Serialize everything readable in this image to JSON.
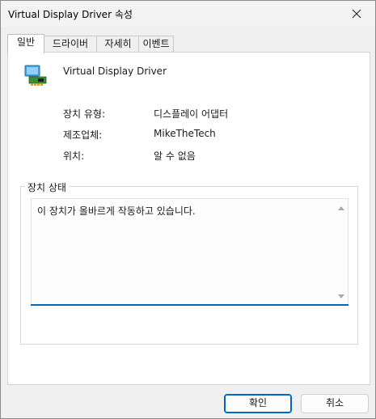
{
  "window": {
    "title": "Virtual Display Driver 속성"
  },
  "tabs": [
    {
      "label": "일반"
    },
    {
      "label": "드라이버"
    },
    {
      "label": "자세히"
    },
    {
      "label": "이벤트"
    }
  ],
  "device": {
    "name": "Virtual Display Driver"
  },
  "properties": {
    "type_label": "장치 유형:",
    "type_value": "디스플레이 어댑터",
    "manufacturer_label": "제조업체:",
    "manufacturer_value": "MikeTheTech",
    "location_label": "위치:",
    "location_value": "알 수 없음"
  },
  "status": {
    "group_label": "장치 상태",
    "text": "이 장치가 올바르게 작동하고 있습니다."
  },
  "buttons": {
    "ok": "확인",
    "cancel": "취소"
  },
  "colors": {
    "accent": "#0067c0"
  }
}
